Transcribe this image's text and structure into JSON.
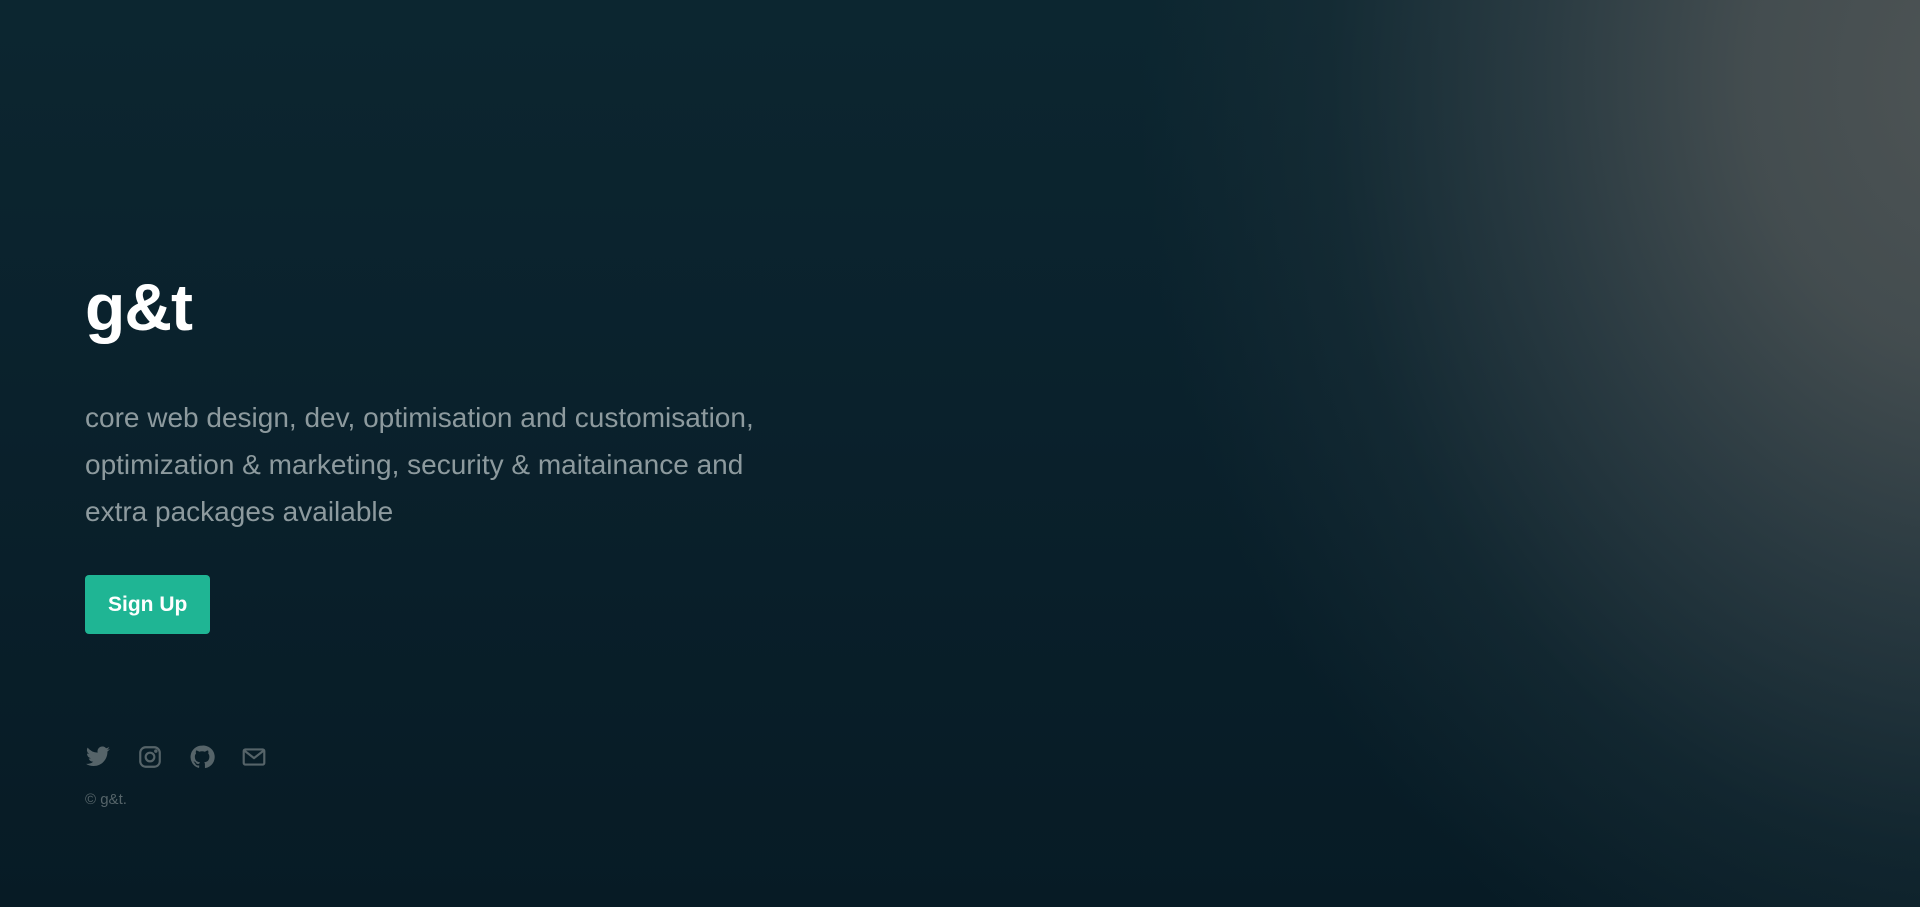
{
  "hero": {
    "brand": "g&t",
    "tagline": "core web design, dev, optimisation and customisation, optimization & marketing, security & maitainance and extra packages available",
    "cta_label": "Sign Up"
  },
  "footer": {
    "social": [
      {
        "icon": "twitter-icon"
      },
      {
        "icon": "instagram-icon"
      },
      {
        "icon": "github-icon"
      },
      {
        "icon": "mail-icon"
      }
    ],
    "copyright": "© g&t."
  },
  "colors": {
    "accent": "#1fb594",
    "background_dark": "#0b1f29",
    "heading": "#ffffff",
    "muted_text": "#8d9a9e",
    "icon": "#566469"
  }
}
